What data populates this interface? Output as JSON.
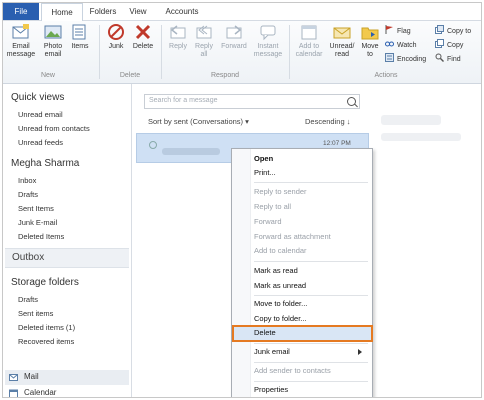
{
  "tabs": [
    "File",
    "Home",
    "Folders",
    "View",
    "Accounts"
  ],
  "ribbon": {
    "new": {
      "email": "Email message",
      "photo": "Photo email",
      "items": "Items",
      "group": "New"
    },
    "delete": {
      "junk": "Junk",
      "delete": "Delete",
      "group": "Delete"
    },
    "respond": {
      "reply": "Reply",
      "reply_all": "Reply all",
      "forward": "Forward",
      "instant": "Instant message",
      "group": "Respond"
    },
    "actions": {
      "add_calendar": "Add to calendar",
      "unread": "Unread/ read",
      "move": "Move to",
      "flag": "Flag",
      "watch": "Watch",
      "encoding": "Encoding",
      "copy_to": "Copy to",
      "copy": "Copy",
      "find": "Find",
      "group": "Actions"
    }
  },
  "sidebar": {
    "quick_views": "Quick views",
    "quick_items": [
      "Unread email",
      "Unread from contacts",
      "Unread feeds"
    ],
    "account": "Megha Sharma",
    "account_items": [
      "Inbox",
      "Drafts",
      "Sent Items",
      "Junk E-mail",
      "Deleted Items"
    ],
    "outbox": "Outbox",
    "storage": "Storage folders",
    "storage_items": [
      "Drafts",
      "Sent items",
      "Deleted items (1)",
      "Recovered items"
    ],
    "nav": [
      "Mail",
      "Calendar"
    ]
  },
  "messages": {
    "search_placeholder": "Search for a message",
    "sort_by": "Sort by sent (Conversations)",
    "order": "Descending",
    "time": "12:07 PM"
  },
  "context_menu": {
    "open": "Open",
    "print": "Print...",
    "reply_sender": "Reply to sender",
    "reply_all": "Reply to all",
    "forward": "Forward",
    "forward_attachment": "Forward as attachment",
    "add_calendar": "Add to calendar",
    "mark_read": "Mark as read",
    "mark_unread": "Mark as unread",
    "move": "Move to folder...",
    "copy": "Copy to folder...",
    "delete": "Delete",
    "junk": "Junk email",
    "add_sender": "Add sender to contacts",
    "properties": "Properties"
  },
  "colors": {
    "accent": "#2a5fb0",
    "highlight_border": "#e57a22",
    "selection": "#cfe0f4"
  }
}
